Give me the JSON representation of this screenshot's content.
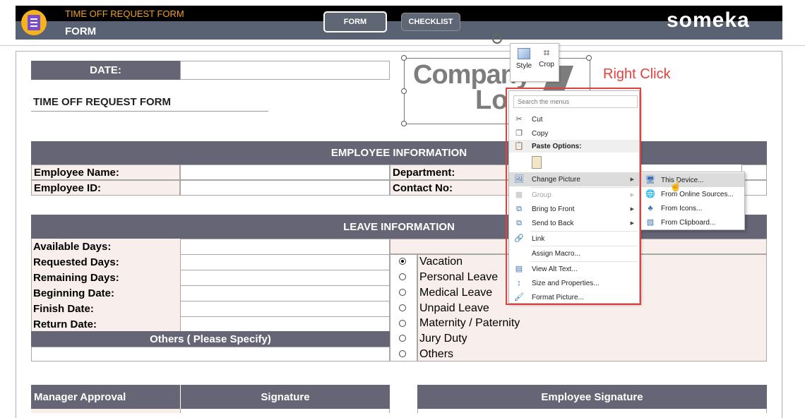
{
  "header": {
    "title": "TIME OFF REQUEST FORM",
    "subtitle": "FORM",
    "form_button": "FORM",
    "checklist_button": "CHECKLIST",
    "brand": "someka"
  },
  "form": {
    "date_label": "DATE:",
    "form_title": "TIME OFF REQUEST FORM",
    "logo_text_line1": "Company",
    "logo_text_line2": "Log",
    "employee_section": "EMPLOYEE INFORMATION",
    "employee_name_label": "Employee Name:",
    "employee_id_label": "Employee ID:",
    "department_label": "Department:",
    "contact_label": "Contact No:",
    "leave_section": "LEAVE INFORMATION",
    "leave_fields": [
      "Available Days:",
      "Requested Days:",
      "Remaining Days:",
      "Beginning Date:",
      "Finish Date:",
      "Return Date:"
    ],
    "others_label": "Others ( Please Specify)",
    "leave_types": [
      "Vacation",
      "Personal Leave",
      "Medical Leave",
      "Unpaid Leave",
      "Maternity / Paternity",
      "Jury Duty",
      "Others"
    ],
    "selected_leave_type": "Vacation",
    "manager_approval": "Manager Approval",
    "signature": "Signature",
    "employee_signature": "Employee Signature"
  },
  "mini_toolbar": {
    "style": "Style",
    "crop": "Crop"
  },
  "context_menu": {
    "search_placeholder": "Search the menus",
    "cut": "Cut",
    "copy": "Copy",
    "paste_options": "Paste Options:",
    "change_picture": "Change Picture",
    "group": "Group",
    "bring_to_front": "Bring to Front",
    "send_to_back": "Send to Back",
    "link": "Link",
    "assign_macro": "Assign Macro...",
    "view_alt_text": "View Alt Text...",
    "size_properties": "Size and Properties...",
    "format_picture": "Format Picture..."
  },
  "submenu": {
    "this_device": "This Device...",
    "online_sources": "From Online Sources...",
    "from_icons": "From Icons...",
    "from_clipboard": "From Clipboard..."
  },
  "annotation": {
    "right_click": "Right Click"
  },
  "colors": {
    "header_band": "#586272",
    "section_header": "#666575",
    "accent_orange": "#f0a21b",
    "highlight_red": "#e0403e",
    "label_pink": "#f8eeeb"
  }
}
